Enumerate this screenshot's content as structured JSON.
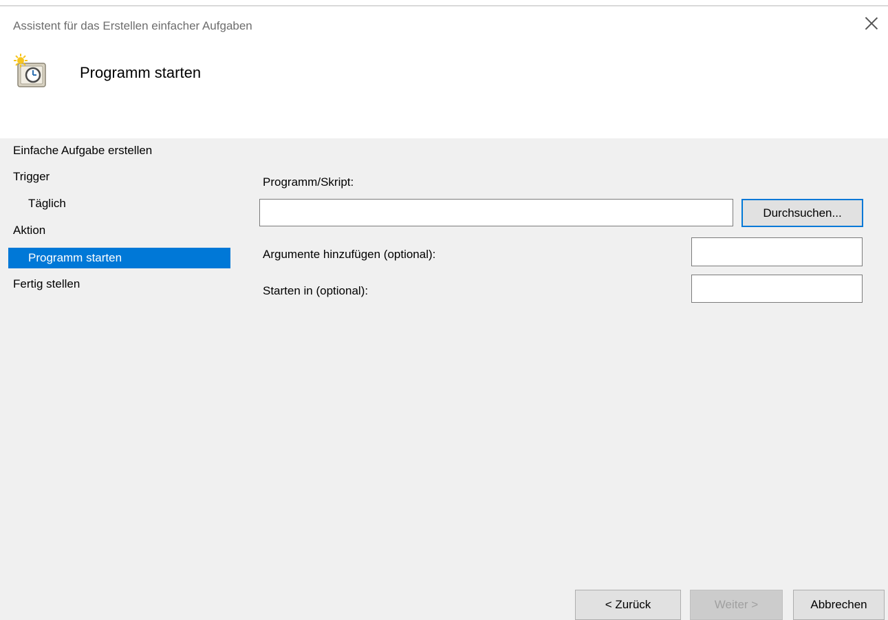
{
  "window": {
    "title": "Assistent für das Erstellen einfacher Aufgaben",
    "close_icon": "close-icon"
  },
  "header": {
    "icon": "scheduled-task-clock-icon",
    "title": "Programm starten"
  },
  "nav": {
    "items": [
      {
        "label": "Einfache Aufgabe erstellen"
      },
      {
        "label": "Trigger"
      },
      {
        "label": "Täglich"
      },
      {
        "label": "Aktion"
      },
      {
        "label": "Programm starten",
        "selected": true
      },
      {
        "label": "Fertig stellen"
      }
    ],
    "selected_color": "#0078d7"
  },
  "form": {
    "program_label": "Programm/Skript:",
    "program_value": "",
    "browse_button": "Durchsuchen...",
    "arguments_label": "Argumente hinzufügen (optional):",
    "arguments_value": "",
    "start_in_label": "Starten in (optional):",
    "start_in_value": ""
  },
  "footer": {
    "back_button": "< Zurück",
    "next_button": "Weiter >",
    "cancel_button": "Abbrechen"
  }
}
